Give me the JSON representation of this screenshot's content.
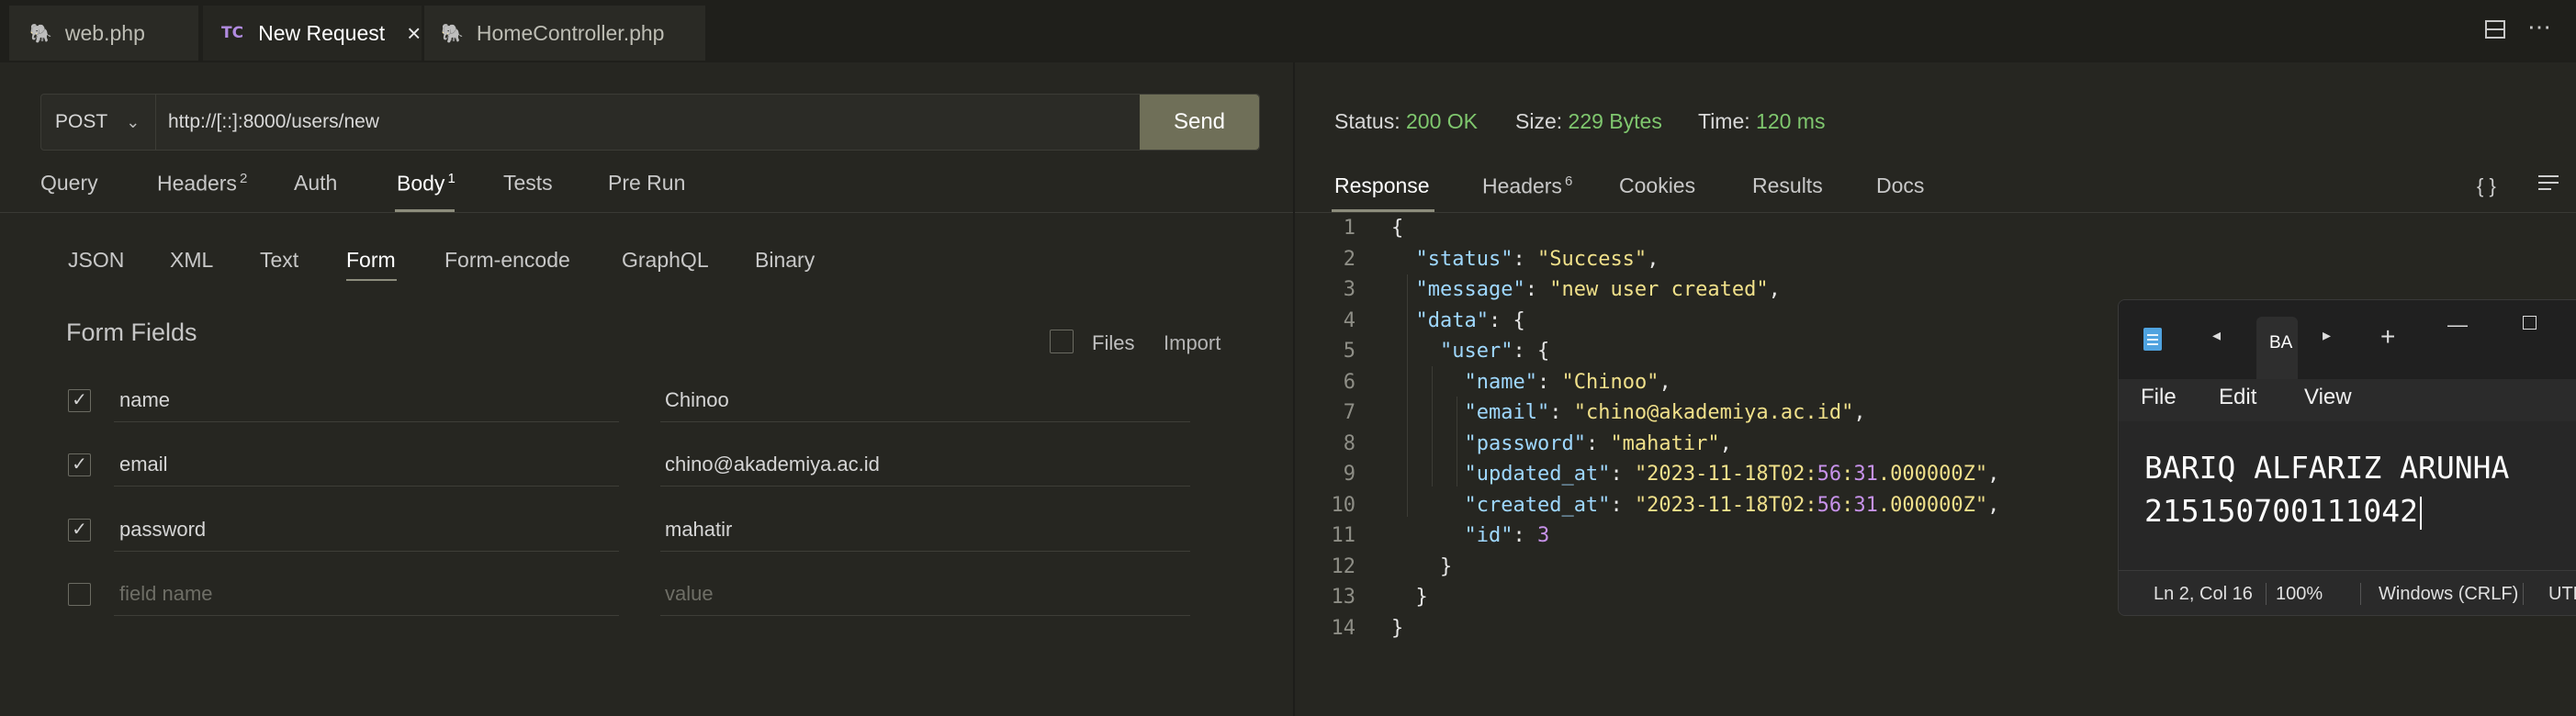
{
  "tabs": [
    {
      "label": "web.php"
    },
    {
      "label": "New Request",
      "badge": "TC"
    },
    {
      "label": "HomeController.php"
    }
  ],
  "tab_close": "×",
  "icons": {
    "split": "split-editor-icon",
    "more": "more-icon",
    "elephant": "php-elephant-icon"
  },
  "request": {
    "method": "POST",
    "url": "http://[::]:8000/users/new",
    "send_label": "Send",
    "tabs": [
      {
        "label": "Query"
      },
      {
        "label": "Headers",
        "count": "2"
      },
      {
        "label": "Auth"
      },
      {
        "label": "Body",
        "count": "1"
      },
      {
        "label": "Tests"
      },
      {
        "label": "Pre Run"
      }
    ],
    "active_tab": "Body",
    "body_types": [
      "JSON",
      "XML",
      "Text",
      "Form",
      "Form-encode",
      "GraphQL",
      "Binary"
    ],
    "active_body_type": "Form",
    "form": {
      "title": "Form Fields",
      "files_label": "Files",
      "import_label": "Import",
      "fields": [
        {
          "checked": true,
          "name": "name",
          "value": "Chinoo"
        },
        {
          "checked": true,
          "name": "email",
          "value": "chino@akademiya.ac.id"
        },
        {
          "checked": true,
          "name": "password",
          "value": "mahatir"
        }
      ],
      "new_field": {
        "name_placeholder": "field name",
        "value_placeholder": "value"
      }
    }
  },
  "response": {
    "status_label": "Status:",
    "status_value": "200 OK",
    "size_label": "Size:",
    "size_value": "229 Bytes",
    "time_label": "Time:",
    "time_value": "120 ms",
    "status_color": "#7fc76e",
    "tabs": [
      {
        "label": "Response"
      },
      {
        "label": "Headers",
        "count": "6"
      },
      {
        "label": "Cookies"
      },
      {
        "label": "Results"
      },
      {
        "label": "Docs"
      }
    ],
    "active_tab": "Response",
    "braces_icon": "{ }",
    "code_lines": [
      "{",
      "  \"status\": \"Success\",",
      "  \"message\": \"new user created\",",
      "  \"data\": {",
      "    \"user\": {",
      "      \"name\": \"Chinoo\",",
      "      \"email\": \"chino@akademiya.ac.id\",",
      "      \"password\": \"mahatir\",",
      "      \"updated_at\": \"2023-11-18T02:56:31.000000Z\",",
      "      \"created_at\": \"2023-11-18T02:56:31.000000Z\",",
      "      \"id\": 3",
      "    }",
      "  }",
      "}"
    ]
  },
  "notepad": {
    "tab_label": "BA",
    "menu": [
      "File",
      "Edit",
      "View"
    ],
    "content_lines": [
      "BARIQ ALFARIZ ARUNHA",
      "215150700111042"
    ],
    "status": {
      "position": "Ln 2, Col 16",
      "zoom": "100%",
      "line_ending": "Windows (CRLF)",
      "encoding": "UTF"
    }
  }
}
